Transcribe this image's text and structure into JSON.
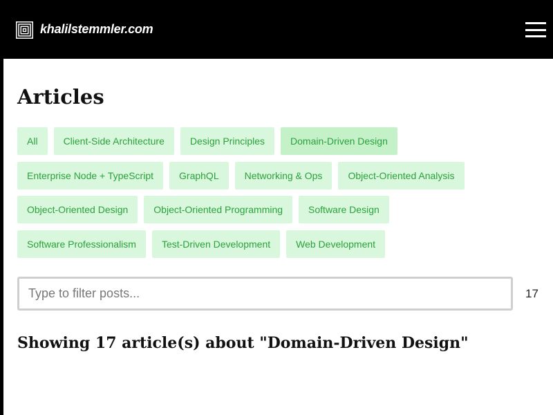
{
  "header": {
    "site_name": "khalilstemmler.com",
    "logo_icon": "square-spiral-logo",
    "menu_icon": "hamburger-menu-icon"
  },
  "main": {
    "title": "Articles",
    "tag_rows": [
      [
        "All",
        "Client-Side Architecture",
        "Design Principles",
        "Domain-Driven Design"
      ],
      [
        "Enterprise Node + TypeScript",
        "GraphQL",
        "Networking & Ops",
        "Object-Oriented Analysis"
      ],
      [
        "Object-Oriented Design",
        "Object-Oriented Programming",
        "Software Design"
      ],
      [
        "Software Professionalism",
        "Test-Driven Development",
        "Web Development"
      ]
    ],
    "active_tag": "Domain-Driven Design",
    "filter": {
      "placeholder": "Type to filter posts...",
      "value": ""
    },
    "count": "17",
    "showing_text": "Showing 17 article(s) about \"Domain-Driven Design\""
  },
  "colors": {
    "tag_bg": "#d9f7dc",
    "tag_text": "#2aa23a",
    "header_bg": "#000000"
  }
}
